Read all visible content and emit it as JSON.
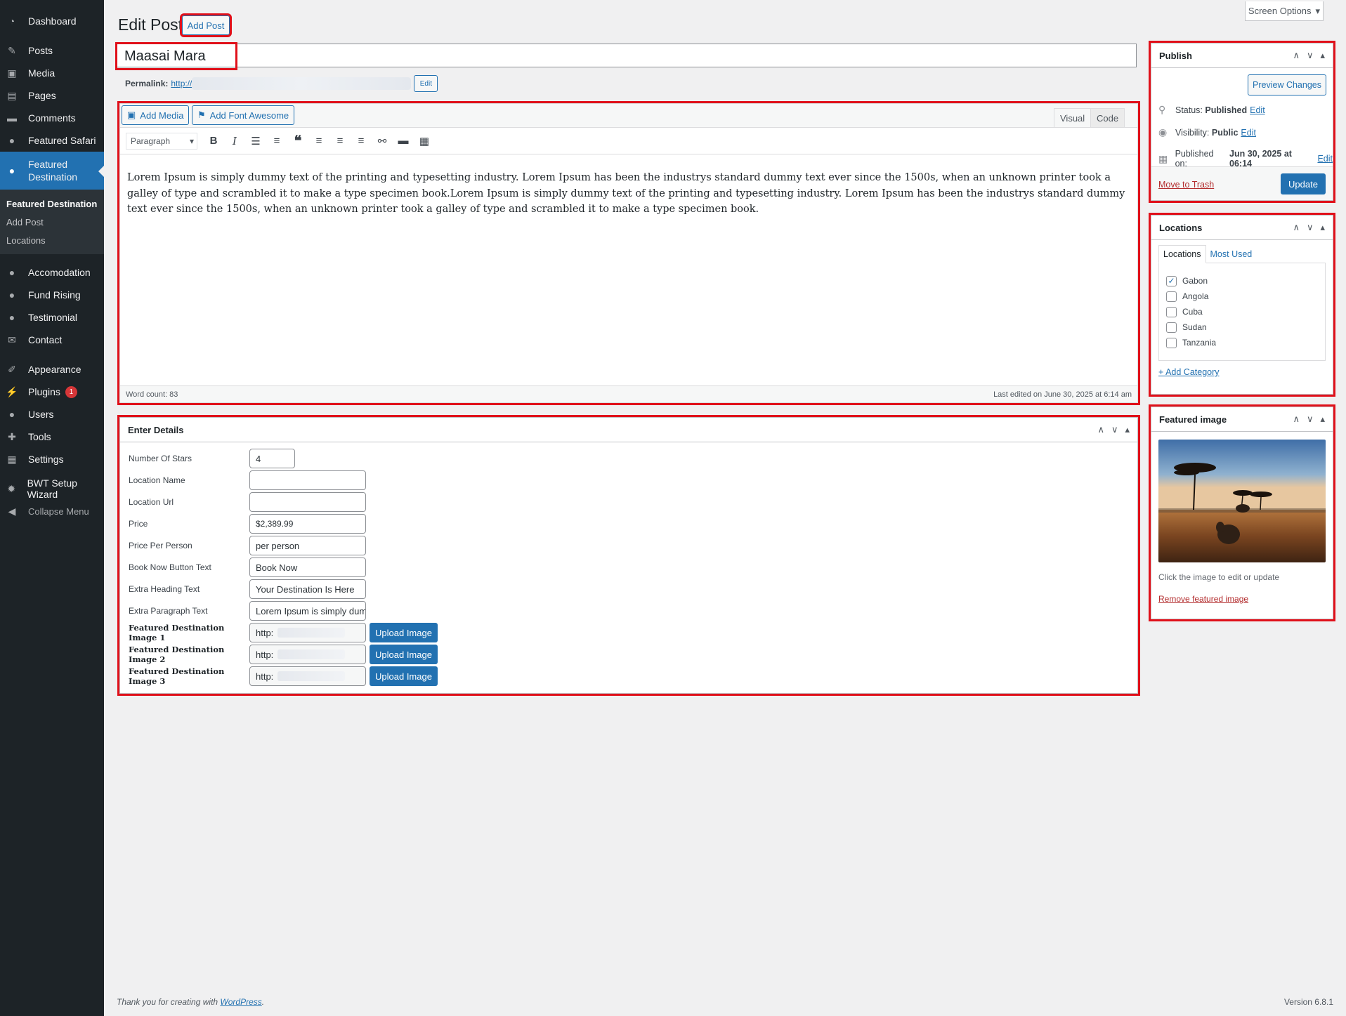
{
  "sidebar": {
    "items": [
      {
        "label": "Dashboard",
        "icon": "dashboard-icon"
      },
      {
        "label": "Posts",
        "icon": "pin-icon"
      },
      {
        "label": "Media",
        "icon": "media-icon"
      },
      {
        "label": "Pages",
        "icon": "pages-icon"
      },
      {
        "label": "Comments",
        "icon": "comment-icon"
      },
      {
        "label": "Featured Safari",
        "icon": "user-icon"
      },
      {
        "label": "Featured Destination",
        "icon": "user-icon"
      },
      {
        "label": "Accomodation",
        "icon": "user-icon"
      },
      {
        "label": "Fund Rising",
        "icon": "user-icon"
      },
      {
        "label": "Testimonial",
        "icon": "user-icon"
      },
      {
        "label": "Contact",
        "icon": "mail-icon"
      },
      {
        "label": "Appearance",
        "icon": "brush-icon"
      },
      {
        "label": "Plugins",
        "icon": "plugin-icon",
        "badge": "1"
      },
      {
        "label": "Users",
        "icon": "users-icon"
      },
      {
        "label": "Tools",
        "icon": "wrench-icon"
      },
      {
        "label": "Settings",
        "icon": "settings-icon"
      },
      {
        "label": "BWT Setup Wizard",
        "icon": "gear-icon"
      },
      {
        "label": "Collapse Menu",
        "icon": "collapse-icon"
      }
    ],
    "submenu": [
      "Featured Destination",
      "Add Post",
      "Locations"
    ]
  },
  "header": {
    "screen_options": "Screen Options",
    "title": "Edit Post",
    "add_post": "Add Post"
  },
  "post": {
    "title": "Maasai Mara",
    "permalink_label": "Permalink:",
    "permalink_url": "http://",
    "permalink_edit": "Edit"
  },
  "editor": {
    "add_media": "Add Media",
    "add_font_awesome": "Add Font Awesome",
    "tab_visual": "Visual",
    "tab_code": "Code",
    "format": "Paragraph",
    "content": "Lorem Ipsum is simply dummy text of the printing and typesetting industry. Lorem Ipsum has been the industrys standard dummy text ever since the 1500s, when an unknown printer took a galley of type and scrambled it to make a type specimen book.Lorem Ipsum is simply dummy text of the printing and typesetting industry. Lorem Ipsum has been the industrys standard dummy text ever since the 1500s, when an unknown printer took a galley of type and scrambled it to make a type specimen book.",
    "word_count": "Word count: 83",
    "last_edited": "Last edited on June 30, 2025 at 6:14 am"
  },
  "details": {
    "title": "Enter Details",
    "fields": [
      {
        "label": "Number Of Stars",
        "value": "4"
      },
      {
        "label": "Location Name",
        "value": ""
      },
      {
        "label": "Location Url",
        "value": ""
      },
      {
        "label": "Price",
        "value": "$2,389.99"
      },
      {
        "label": "Price Per Person",
        "value": "per person"
      },
      {
        "label": "Book Now Button Text",
        "value": "Book Now"
      },
      {
        "label": "Extra Heading Text",
        "value": "Your Destination Is Here"
      },
      {
        "label": "Extra Paragraph Text",
        "value": "Lorem Ipsum is simply dummy text"
      },
      {
        "label": "Featured Destination Image 1",
        "value": "http:"
      },
      {
        "label": "Featured Destination Image 2",
        "value": "http:"
      },
      {
        "label": "Featured Destination Image 3",
        "value": "http:"
      }
    ],
    "upload_label": "Upload Image"
  },
  "publish": {
    "title": "Publish",
    "preview": "Preview Changes",
    "status_label": "Status:",
    "status_value": "Published",
    "visibility_label": "Visibility:",
    "visibility_value": "Public",
    "published_label": "Published on:",
    "published_value": "Jun 30, 2025 at 06:14",
    "edit": "Edit",
    "trash": "Move to Trash",
    "update": "Update"
  },
  "locations": {
    "title": "Locations",
    "tab_all": "Locations",
    "tab_most_used": "Most Used",
    "items": [
      {
        "label": "Gabon",
        "checked": true
      },
      {
        "label": "Angola",
        "checked": false
      },
      {
        "label": "Cuba",
        "checked": false
      },
      {
        "label": "Sudan",
        "checked": false
      },
      {
        "label": "Tanzania",
        "checked": false
      }
    ],
    "add_category": "+ Add Category"
  },
  "featured_image": {
    "title": "Featured image",
    "hint": "Click the image to edit or update",
    "remove": "Remove featured image"
  },
  "footer": {
    "thanks_prefix": "Thank you for creating with",
    "wordpress": "WordPress",
    "thanks_suffix": ".",
    "version": "Version 6.8.1"
  },
  "colors": {
    "accent": "#2271b1",
    "sidebar_bg": "#1d2327",
    "highlight": "#e0101a"
  }
}
